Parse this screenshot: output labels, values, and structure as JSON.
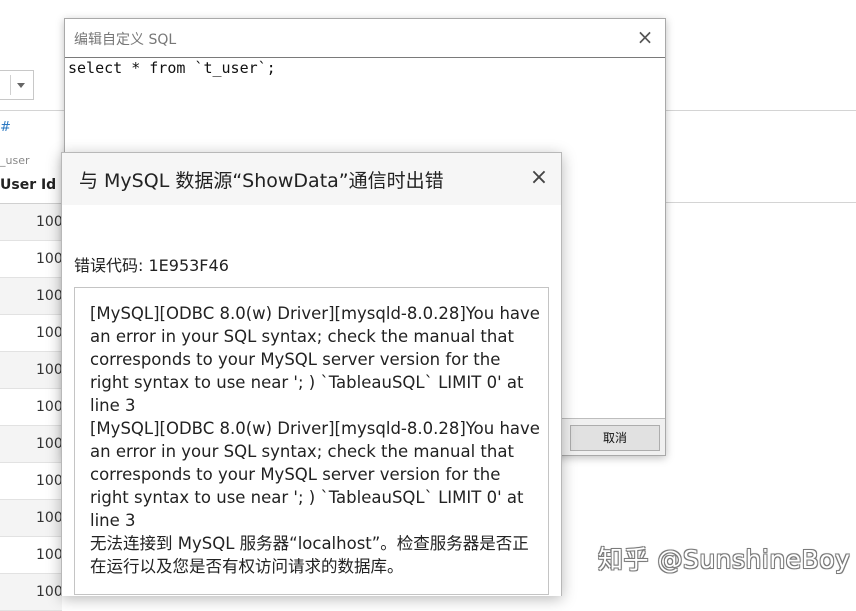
{
  "background": {
    "column_marker": "#",
    "source_label": "_user",
    "column_header": "User Id",
    "row_values": [
      "100",
      "100",
      "100",
      "100",
      "100",
      "100",
      "100",
      "100",
      "100",
      "100",
      "100"
    ]
  },
  "sql_dialog": {
    "title": "编辑自定义 SQL",
    "query": "select * from `t_user`;",
    "cancel_label": "取消"
  },
  "error_dialog": {
    "title": "与 MySQL 数据源“ShowData”通信时出错",
    "error_code": "错误代码: 1E953F46",
    "message": "[MySQL][ODBC 8.0(w) Driver][mysqld-8.0.28]You have an error in your SQL syntax; check the manual that corresponds to your MySQL server version for the right syntax to use near '; ) `TableauSQL` LIMIT 0' at line 3\n[MySQL][ODBC 8.0(w) Driver][mysqld-8.0.28]You have an error in your SQL syntax; check the manual that corresponds to your MySQL server version for the right syntax to use near '; ) `TableauSQL` LIMIT 0' at line 3\n无法连接到 MySQL 服务器“localhost”。检查服务器是否正在运行以及您是否有权访问请求的数据库。"
  },
  "watermark": "知乎 @SunshineBoy",
  "icons": {
    "close": "×",
    "dropdown": "chevron-down"
  }
}
